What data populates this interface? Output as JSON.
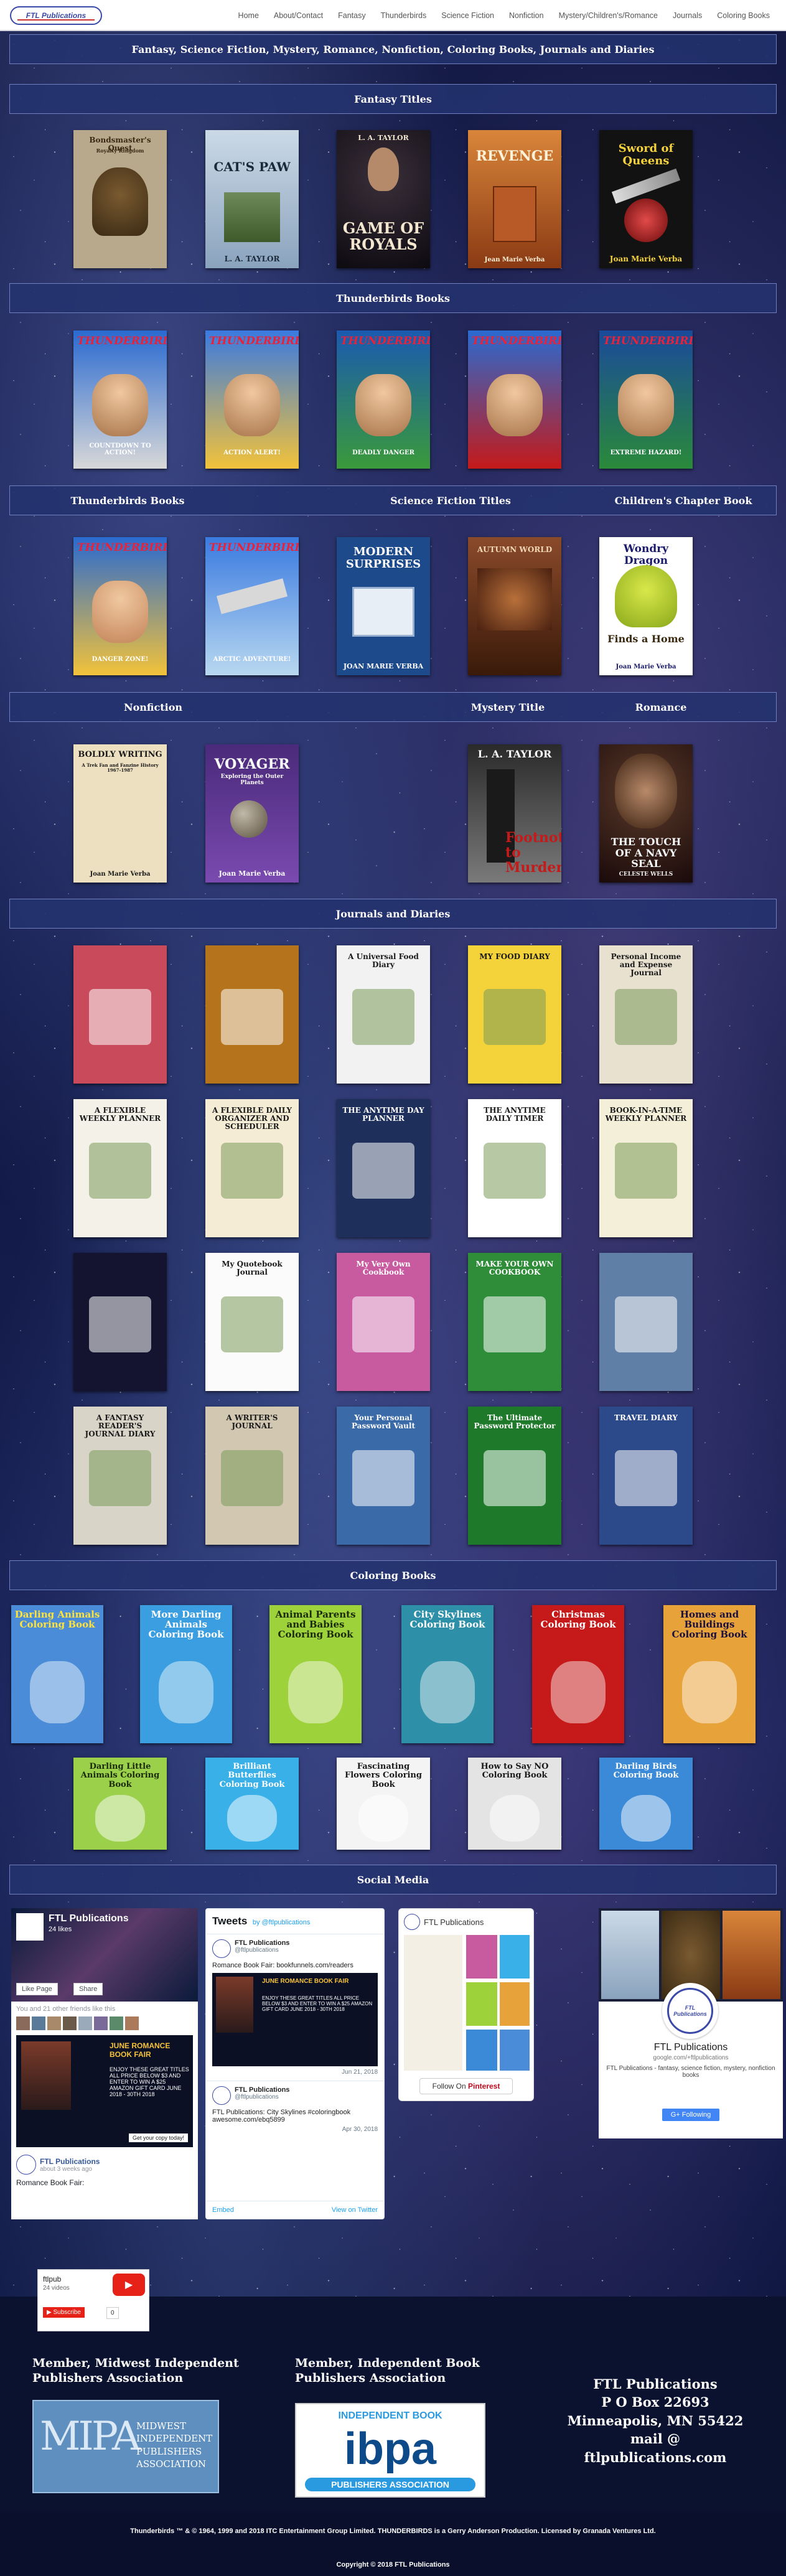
{
  "nav": {
    "logo": "FTL Publications",
    "links": [
      "Home",
      "About/Contact",
      "Fantasy",
      "Thunderbirds",
      "Science Fiction",
      "Nonfiction",
      "Mystery/Children's/Romance",
      "Journals",
      "Coloring Books"
    ]
  },
  "headline": "Fantasy, Science Fiction, Mystery, Romance, Nonfiction, Coloring Books, Journals and Diaries",
  "sections": {
    "fantasy": "Fantasy Titles",
    "thunderbirds": "Thunderbirds Books",
    "mixed1": [
      "Thunderbirds Books",
      "Science Fiction Titles",
      "Children's Chapter Book"
    ],
    "mixed2": [
      "Nonfiction",
      "Mystery Title",
      "Romance"
    ],
    "journals": "Journals and Diaries",
    "coloring": "Coloring Books",
    "social": "Social Media"
  },
  "fantasy_books": [
    {
      "title": "Bondsmaster's Quest",
      "author": "Royalty Kingdom",
      "bg": "#b9a98c",
      "fg": "#3a2a14"
    },
    {
      "title": "CAT'S PAW",
      "author": "L. A. TAYLOR",
      "bg": "#9fb3c9",
      "fg": "#1a2a3a"
    },
    {
      "title": "GAME OF ROYALS",
      "author": "L. A. TAYLOR",
      "bg": "#15121c",
      "fg": "#f3e7d0"
    },
    {
      "title": "REVENGE",
      "author": "Jean Marie Verba",
      "bg": "#c3632a",
      "fg": "#fff2d8"
    },
    {
      "title": "Sword of Queens",
      "author": "Joan Marie Verba",
      "bg": "#121212",
      "fg": "#f5d23c"
    }
  ],
  "thunderbirds_books": [
    {
      "title": "THUNDERBIRDS",
      "subtitle": "COUNTDOWN TO ACTION!"
    },
    {
      "title": "THUNDERBIRDS",
      "subtitle": "ACTION ALERT!"
    },
    {
      "title": "THUNDERBIRDS",
      "subtitle": "DEADLY DANGER"
    },
    {
      "title": "THUNDERBIRDS",
      "subtitle": ""
    },
    {
      "title": "THUNDERBIRDS",
      "subtitle": "EXTREME HAZARD!"
    }
  ],
  "mixed1_books": [
    {
      "title": "THUNDERBIRDS",
      "subtitle": "DANGER ZONE!"
    },
    {
      "title": "THUNDERBIRDS",
      "subtitle": "ARCTIC ADVENTURE!"
    },
    {
      "title": "MODERN SURPRISES",
      "author": "JOAN MARIE VERBA"
    },
    {
      "title": "AUTUMN WORLD",
      "author": ""
    },
    {
      "title": "Wondry Dragon",
      "subtitle": "Finds a Home",
      "author": "Joan Marie Verba"
    }
  ],
  "mixed2_books": [
    {
      "title": "BOLDLY WRITING",
      "subtitle": "A Trek Fan and Fanzine History 1967-1987",
      "author": "Joan Marie Verba"
    },
    {
      "title": "VOYAGER",
      "subtitle": "Exploring the Outer Planets",
      "author": "Joan Marie Verba"
    },
    {
      "title": "Footnote to Murder",
      "author": "L. A. TAYLOR"
    },
    {
      "title": "THE TOUCH OF A NAVY SEAL",
      "author": "CELESTE WELLS"
    }
  ],
  "journals": [
    [
      {
        "title": "",
        "bg": "#c94a5a"
      },
      {
        "title": "",
        "bg": "#b5741c"
      },
      {
        "title": "A Universal Food Diary",
        "bg": "#f2f2f2"
      },
      {
        "title": "MY FOOD DIARY",
        "bg": "#f3d23a"
      },
      {
        "title": "Personal Income and Expense Journal",
        "bg": "#e8e1d0"
      }
    ],
    [
      {
        "title": "A FLEXIBLE WEEKLY PLANNER",
        "bg": "#f4f1e8"
      },
      {
        "title": "A FLEXIBLE DAILY ORGANIZER AND SCHEDULER",
        "bg": "#f4ecd4"
      },
      {
        "title": "THE ANYTIME DAY PLANNER",
        "bg": "#1d2f5a"
      },
      {
        "title": "THE ANYTIME DAILY TIMER",
        "bg": "#ffffff"
      },
      {
        "title": "BOOK-IN-A-TIME WEEKLY PLANNER",
        "bg": "#f3efd8"
      }
    ],
    [
      {
        "title": "",
        "bg": "#141430"
      },
      {
        "title": "My Quotebook Journal",
        "bg": "#fbfbfb"
      },
      {
        "title": "My Very Own Cookbook",
        "bg": "#c85aa0"
      },
      {
        "title": "MAKE YOUR OWN COOKBOOK",
        "bg": "#2f8d3a"
      },
      {
        "title": "",
        "bg": "#5f7fa6"
      }
    ],
    [
      {
        "title": "A FANTASY READER'S JOURNAL DIARY",
        "bg": "#d9d4c8"
      },
      {
        "title": "A WRITER'S JOURNAL",
        "bg": "#d2c8b2"
      },
      {
        "title": "Your Personal Password Vault",
        "bg": "#3a6aa8"
      },
      {
        "title": "The Ultimate Password Protector",
        "bg": "#1e7a2a"
      },
      {
        "title": "TRAVEL DIARY",
        "bg": "#2c4a8a"
      }
    ]
  ],
  "coloring_row1": [
    {
      "title": "Darling Animals Coloring Book",
      "bg": "#4a8cd8",
      "fg": "#ffe23a"
    },
    {
      "title": "More Darling Animals Coloring Book",
      "bg": "#3a9ee0",
      "fg": "#ffffff"
    },
    {
      "title": "Animal Parents and Babies Coloring Book",
      "bg": "#9ed23a",
      "fg": "#1a2a0a"
    },
    {
      "title": "City Skylines Coloring Book",
      "bg": "#2d8fa8",
      "fg": "#ffffff"
    },
    {
      "title": "Christmas Coloring Book",
      "bg": "#c61a1a",
      "fg": "#ffffff"
    },
    {
      "title": "Homes and Buildings Coloring Book",
      "bg": "#e8a23a",
      "fg": "#1a1040"
    }
  ],
  "coloring_row2": [
    {
      "title": "Darling Little Animals Coloring Book",
      "bg": "#9ad04a",
      "fg": "#1a2a0a"
    },
    {
      "title": "Brilliant Butterflies Coloring Book",
      "bg": "#3ab0e8",
      "fg": "#ffffff"
    },
    {
      "title": "Fascinating Flowers Coloring Book",
      "bg": "#f4f4f4",
      "fg": "#1a1a1a"
    },
    {
      "title": "How to Say NO Coloring Book",
      "bg": "#e4e4e4",
      "fg": "#1a1a1a"
    },
    {
      "title": "Darling Birds Coloring Book",
      "bg": "#3a8ad8",
      "fg": "#ffffff"
    }
  ],
  "facebook": {
    "page_name": "FTL Publications",
    "likes": "24 likes",
    "like_button": "Like Page",
    "share_button": "Share",
    "friends_text": "You and 21 other friends like this",
    "post_author": "FTL Publications",
    "post_time": "about 3 weeks ago",
    "post_text": "Romance Book Fair:",
    "promo_title": "JUNE ROMANCE BOOK FAIR",
    "promo_body": "ENJOY THESE GREAT TITLES ALL PRICE BELOW $3 AND ENTER TO WIN A $25 AMAZON GIFT CARD JUNE 2018 - 30TH 2018",
    "promo_cta": "Get your copy today!"
  },
  "twitter": {
    "heading": "Tweets",
    "by": "by @ftlpublications",
    "tweets": [
      {
        "name": "FTL Publications",
        "handle": "@ftlpublications",
        "text": "Romance Book Fair: bookfunnels.com/readers",
        "date": "Jun 21, 2018"
      },
      {
        "name": "FTL Publications",
        "handle": "@ftlpublications",
        "text": "FTL Publications: City Skylines #coloringbook awesome.com/ebq5899",
        "date": "Apr 30, 2018"
      }
    ],
    "embed": "Embed",
    "view": "View on Twitter"
  },
  "pinterest": {
    "name": "FTL Publications",
    "follow": "Follow On",
    "brand": "Pinterest"
  },
  "gplus": {
    "name": "FTL Publications",
    "url": "google.com/+ftlpublications",
    "desc": "FTL Publications - fantasy, science fiction, mystery, nonfiction books",
    "follow": "Following",
    "logo_text": "FTL Publications"
  },
  "youtube": {
    "name": "ftlpub",
    "videos": "24 videos",
    "subscribe": "Subscribe",
    "count": "0"
  },
  "footer": {
    "mipa_heading": "Member, Midwest Independent Publishers Association",
    "mipa_logo": "MIPA",
    "mipa_logo_text": [
      "MIDWEST",
      "INDEPENDENT",
      "PUBLISHERS",
      "ASSOCIATION"
    ],
    "ibpa_heading": "Member, Independent Book Publishers Association",
    "ibpa_logo_top": "INDEPENDENT BOOK",
    "ibpa_logo_main": "ibpa",
    "ibpa_logo_bottom": "PUBLISHERS ASSOCIATION",
    "address": [
      "FTL Publications",
      "P O Box 22693",
      "Minneapolis, MN 55422",
      "mail @ ftlpublications.com"
    ],
    "legal": "Thunderbirds ™ & © 1964, 1999 and 2018 ITC Entertainment Group Limited. THUNDERBIRDS is a Gerry Anderson Production. Licensed by Granada Ventures Ltd.",
    "copyright": "Copyright © 2018 FTL Publications"
  }
}
